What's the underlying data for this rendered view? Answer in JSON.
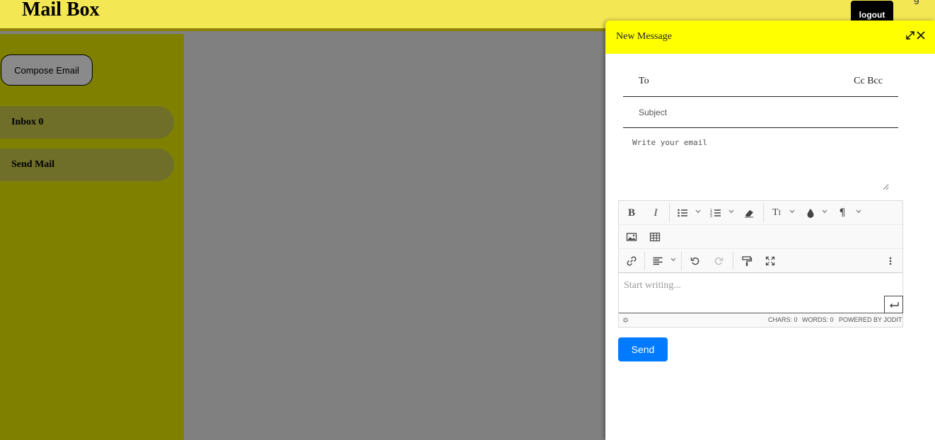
{
  "header": {
    "title": "Mail Box",
    "logout_label": "logout"
  },
  "sidebar": {
    "compose_label": "Compose Email",
    "items": [
      {
        "label": "Inbox 0"
      },
      {
        "label": "Send Mail"
      }
    ]
  },
  "compose": {
    "title": "New Message",
    "to_label": "To",
    "cc_bcc_label": "Cc Bcc",
    "subject_placeholder": "Subject",
    "body_placeholder": "Write your email",
    "editor": {
      "placeholder": "Start writing...",
      "toolbar_icons": [
        "bold-icon",
        "italic-icon",
        "unordered-list-icon",
        "ordered-list-icon",
        "eraser-icon",
        "font-size-icon",
        "color-drop-icon",
        "paragraph-icon",
        "image-icon",
        "table-icon",
        "link-icon",
        "align-icon",
        "undo-icon",
        "redo-icon",
        "format-painter-icon",
        "fullsize-icon",
        "more-dots-icon"
      ],
      "status": {
        "chars": "CHARS: 0",
        "words": "WORDS: 0",
        "powered": "POWERED BY JODIT"
      }
    },
    "send_label": "Send"
  },
  "colors": {
    "header_bg": "#f4e754",
    "sidebar_bg": "#808000",
    "panel_head_bg": "#ffff00",
    "send_bg": "#007bff"
  }
}
